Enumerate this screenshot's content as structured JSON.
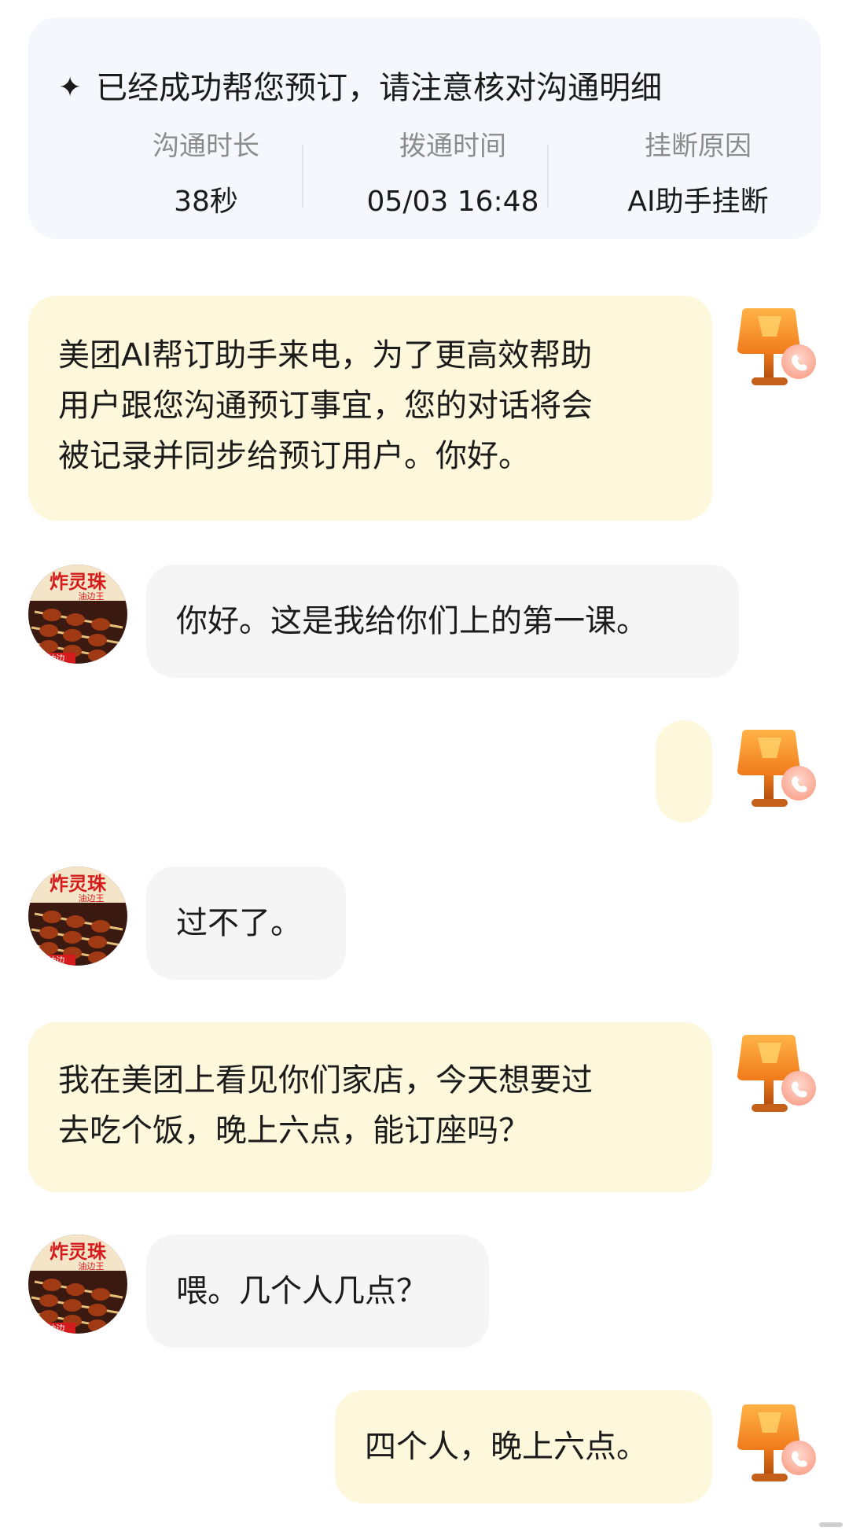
{
  "summary": {
    "title": "已经成功帮您预订，请注意核对沟通明细",
    "stats": [
      {
        "label": "沟通时长",
        "value": "38秒"
      },
      {
        "label": "拨通时间",
        "value": "05/03 16:48"
      },
      {
        "label": "挂断原因",
        "value": "AI助手挂断"
      }
    ]
  },
  "avatar_text": {
    "shop_sign_top": "炸灵珠",
    "shop_sign_sub": "油边王",
    "shop_sign_bottom": "大油边"
  },
  "messages": [
    {
      "speaker": "ai",
      "text": "美团AI帮订助手来电，为了更高效帮助\n用户跟您沟通预订事宜，您的对话将会\n被记录并同步给预订用户。你好。"
    },
    {
      "speaker": "shop",
      "text": "你好。这是我给你们上的第一课。"
    },
    {
      "speaker": "ai",
      "text": ""
    },
    {
      "speaker": "shop",
      "text": "过不了。"
    },
    {
      "speaker": "ai",
      "text": "我在美团上看见你们家店，今天想要过\n去吃个饭，晚上六点，能订座吗？"
    },
    {
      "speaker": "shop",
      "text": "喂。几个人几点？"
    },
    {
      "speaker": "ai",
      "text": "四个人，晚上六点。"
    }
  ],
  "colors": {
    "ai_bubble": "#fdf8dc",
    "shop_bubble": "#f5f5f5",
    "summary_bg": "#f6f7fd",
    "label_gray": "#8c8c8c"
  },
  "icons": {
    "ai_avatar": "lamp-phone-icon",
    "shop_avatar": "restaurant-skewers-avatar",
    "sparkle": "sparkle-icon"
  }
}
